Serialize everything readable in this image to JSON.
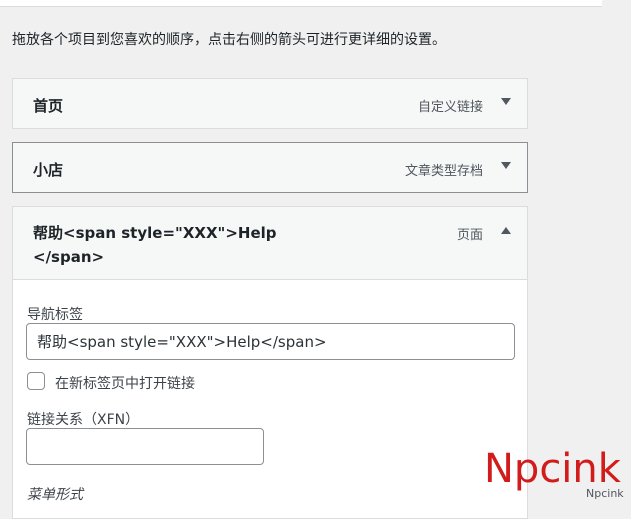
{
  "instructions": "拖放各个项目到您喜欢的顺序，点击右侧的箭头可进行更详细的设置。",
  "menu_items": [
    {
      "title": "首页",
      "type": "自定义链接"
    },
    {
      "title": "小店",
      "type": "文章类型存档"
    },
    {
      "title": "帮助<span style=\"XXX\">Help</span>",
      "type": "页面"
    }
  ],
  "settings": {
    "nav_label": "导航标签",
    "nav_value": "帮助<span style=\"XXX\">Help</span>",
    "open_new_tab_label": "在新标签页中打开链接",
    "xfn_label": "链接关系（XFN）",
    "xfn_value": "",
    "menu_style_label": "菜单形式"
  },
  "watermark": {
    "text": "Npcink",
    "small_text": "Npcink"
  },
  "colors": {
    "watermark": "#d21b1b",
    "border": "#dcdcde",
    "background": "#f0f0f1"
  }
}
